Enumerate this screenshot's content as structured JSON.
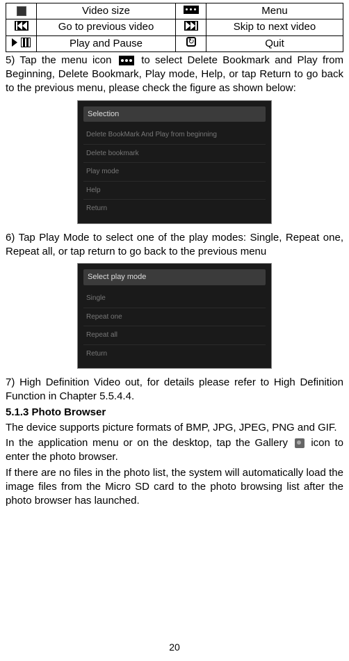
{
  "table": {
    "r1c1_icon": "video-size-icon",
    "r1c2": "Video size",
    "r1c3_icon": "menu-icon",
    "r1c4": "Menu",
    "r2c1_icon": "prev-icon",
    "r2c2": "Go to previous video",
    "r2c3_icon": "next-icon",
    "r2c4": "Skip to next video",
    "r3c1_icon": "play-pause-icon",
    "r3c2": "Play and Pause",
    "r3c3_icon": "quit-icon",
    "r3c4": "Quit"
  },
  "p5_pre": "5) Tap the menu icon ",
  "p5_post": " to select Delete Bookmark and Play from Beginning, Delete Bookmark, Play mode, Help, or tap Return to go back to the previous menu, please check the figure as shown below:",
  "shot1": {
    "header": "Selection",
    "items": [
      "Delete BookMark And Play from beginning",
      "Delete bookmark",
      "Play mode",
      "Help",
      "Return"
    ]
  },
  "p6": "6) Tap Play Mode to select one of the play modes: Single, Repeat one, Repeat all, or tap return to go back to the previous menu",
  "shot2": {
    "header": "Select play mode",
    "items": [
      "Single",
      "Repeat one",
      "Repeat all",
      "Return"
    ]
  },
  "p7": "7) High Definition Video out, for details please refer to High Definition Function in Chapter 5.5.4.4.",
  "heading": "5.1.3 Photo Browser",
  "p_formats": "The device supports picture formats of BMP, JPG, JPEG, PNG and GIF.",
  "p_gallery_pre": "In the application menu or on the desktop, tap the Gallery ",
  "p_gallery_post": " icon to enter the photo browser.",
  "p_nofiles": "If there are no files in the photo list, the system will automatically load the image files from the Micro SD card to the photo browsing list after the photo browser has launched.",
  "page_num": "20"
}
